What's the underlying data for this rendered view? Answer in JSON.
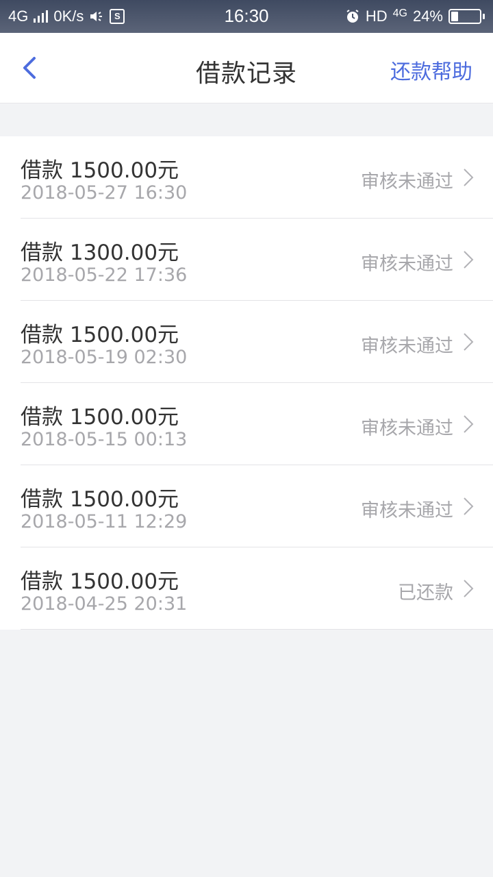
{
  "status_bar": {
    "network": "4G",
    "speed": "0K/s",
    "app_badge": "S",
    "time": "16:30",
    "hd_label": "HD",
    "network_right": "4G",
    "battery_text": "24%",
    "battery_level": 0.24
  },
  "nav": {
    "title": "借款记录",
    "help_label": "还款帮助"
  },
  "colors": {
    "accent": "#4d6cde",
    "primary_text": "#333333",
    "secondary_text": "#a7a7ab",
    "background": "#f2f3f5"
  },
  "records": [
    {
      "title": "借款 1500.00元",
      "date": "2018-05-27 16:30",
      "status": "审核未通过"
    },
    {
      "title": "借款 1300.00元",
      "date": "2018-05-22 17:36",
      "status": "审核未通过"
    },
    {
      "title": "借款 1500.00元",
      "date": "2018-05-19 02:30",
      "status": "审核未通过"
    },
    {
      "title": "借款 1500.00元",
      "date": "2018-05-15 00:13",
      "status": "审核未通过"
    },
    {
      "title": "借款 1500.00元",
      "date": "2018-05-11 12:29",
      "status": "审核未通过"
    },
    {
      "title": "借款 1500.00元",
      "date": "2018-04-25 20:31",
      "status": "已还款"
    }
  ]
}
